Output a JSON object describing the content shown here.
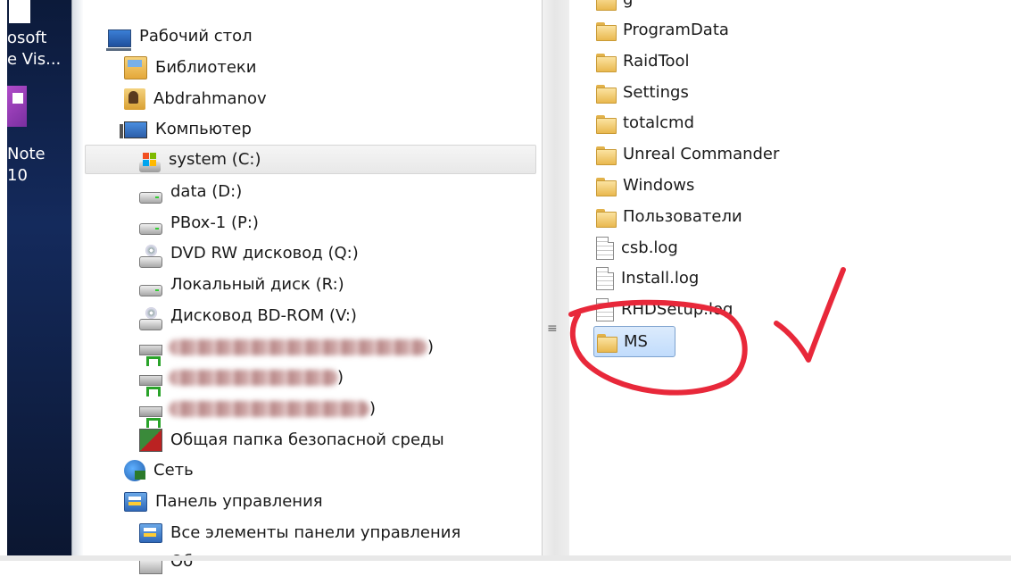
{
  "desktop": {
    "icon1_label_line1": "osoft",
    "icon1_label_line2": "e Vis...",
    "icon2_label_line1": "Note",
    "icon2_label_line2": "10"
  },
  "nav": {
    "items": [
      {
        "label": "Рабочий стол",
        "icon": "desktop-icon"
      },
      {
        "label": "Библиотеки",
        "icon": "libraries-icon"
      },
      {
        "label": "Abdrahmanov",
        "icon": "user-folder-icon"
      },
      {
        "label": "Компьютер",
        "icon": "computer-icon"
      },
      {
        "label": "system (C:)",
        "icon": "system-drive-icon",
        "selected": true
      },
      {
        "label": "data (D:)",
        "icon": "drive-icon"
      },
      {
        "label": "PBox-1 (P:)",
        "icon": "drive-icon"
      },
      {
        "label": "DVD RW дисковод (Q:)",
        "icon": "dvd-drive-icon"
      },
      {
        "label": "Локальный диск (R:)",
        "icon": "drive-icon"
      },
      {
        "label": "Дисковод BD-ROM (V:)",
        "icon": "dvd-drive-icon"
      },
      {
        "label": ")",
        "icon": "network-drive-icon",
        "redacted": true
      },
      {
        "label": ")",
        "icon": "network-drive-icon",
        "redacted": true
      },
      {
        "label": ")",
        "icon": "network-drive-icon",
        "redacted": true
      },
      {
        "label": "Общая папка безопасной среды",
        "icon": "kaspersky-icon"
      },
      {
        "label": "Сеть",
        "icon": "network-icon"
      },
      {
        "label": "Панель управления",
        "icon": "control-panel-icon"
      },
      {
        "label": "Все элементы панели управления",
        "icon": "control-panel-icon"
      },
      {
        "label": "Об",
        "icon": "printer-icon"
      }
    ]
  },
  "content": {
    "partial_top_label": "g",
    "items": [
      {
        "name": "ProgramData",
        "type": "folder"
      },
      {
        "name": "RaidTool",
        "type": "folder"
      },
      {
        "name": "Settings",
        "type": "folder"
      },
      {
        "name": "totalcmd",
        "type": "folder"
      },
      {
        "name": "Unreal Commander",
        "type": "folder"
      },
      {
        "name": "Windows",
        "type": "folder"
      },
      {
        "name": "Пользователи",
        "type": "folder"
      },
      {
        "name": "csb.log",
        "type": "file"
      },
      {
        "name": "Install.log",
        "type": "file"
      },
      {
        "name": "RHDSetup.log",
        "type": "file"
      },
      {
        "name": "MS",
        "type": "folder",
        "selected": true
      }
    ]
  },
  "annotation": {
    "color": "#e8283a"
  }
}
